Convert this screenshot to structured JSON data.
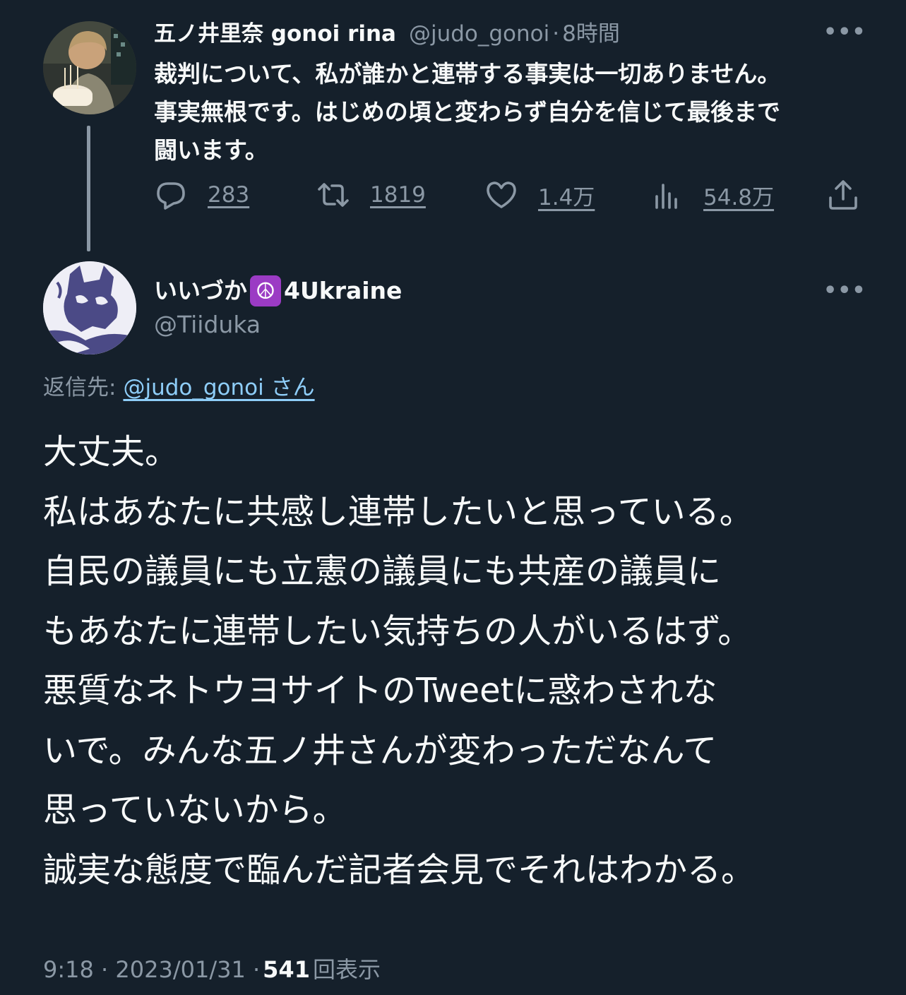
{
  "parent_tweet": {
    "author_name": "五ノ井里奈 gonoi rina",
    "handle": "@judo_gonoi",
    "separator": "·",
    "time": "8時間",
    "text_lines": [
      "裁判について、私が誰かと連帯する事実は一切ありません。",
      "事実無根です。はじめの頃と変わらず自分を信じて最後まで",
      "闘います。"
    ],
    "actions": {
      "replies": "283",
      "retweets": "1819",
      "likes": "1.4万",
      "views": "54.8万"
    },
    "more_label": "•••"
  },
  "reply_tweet": {
    "author_name": "いいづか",
    "emoji": "☮",
    "author_suffix": "4Ukraine",
    "handle": "@Tiiduka",
    "more_label": "•••",
    "reply_to_label": "返信先:",
    "reply_to_link": "@judo_gonoi さん",
    "text_lines": [
      "大丈夫。",
      "私はあなたに共感し連帯したいと思っている。",
      "自民の議員にも立憲の議員にも共産の議員に",
      "もあなたに連帯したい気持ちの人がいるはず。",
      "悪質なネトウヨサイトのTweetに惑わされな",
      "いで。みんな五ノ井さんが変わっただなんて",
      "思っていないから。",
      "誠実な態度で臨んだ記者会見でそれはわかる。"
    ],
    "timestamp": "9:18 · 2023/01/31 ·",
    "view_count": "541",
    "view_label": "回表示"
  },
  "colors": {
    "background": "#15202b",
    "text": "#f7f9f9",
    "secondary": "#8b98a5",
    "link": "#8ecdf8",
    "peace_badge": "#9b3bc4"
  }
}
